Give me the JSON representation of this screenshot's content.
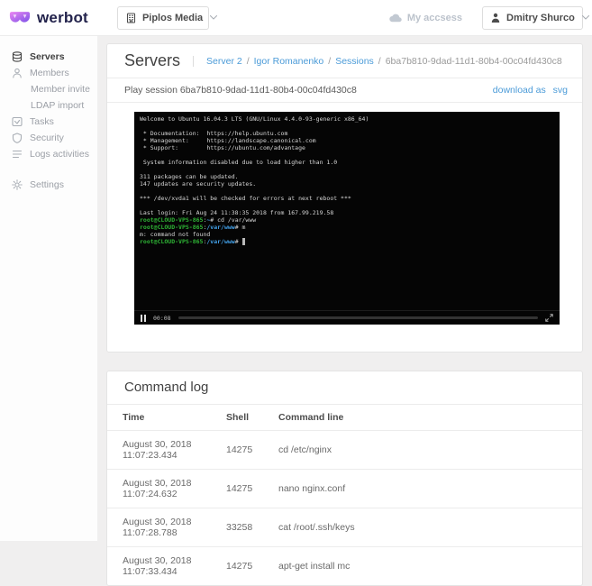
{
  "header": {
    "logo_text": "werbot",
    "company_selector": "Piplos Media",
    "my_access_label": "My accsess",
    "user_name": "Dmitry Shurco"
  },
  "sidebar": {
    "items": [
      {
        "label": "Servers",
        "icon": "server-icon",
        "active": true
      },
      {
        "label": "Members",
        "icon": "user-icon"
      },
      {
        "label": "Member invite",
        "indent": true
      },
      {
        "label": "LDAP import",
        "indent": true
      },
      {
        "label": "Tasks",
        "icon": "tasks-icon"
      },
      {
        "label": "Security",
        "icon": "shield-icon"
      },
      {
        "label": "Logs activities",
        "icon": "logs-icon"
      },
      {
        "label": "Settings",
        "icon": "gear-icon",
        "separated": true
      }
    ]
  },
  "main": {
    "page_title": "Servers",
    "breadcrumb_separator": "/",
    "breadcrumb": [
      {
        "label": "Server 2"
      },
      {
        "label": "Igor Romanenko"
      },
      {
        "label": "Sessions"
      },
      {
        "label": "6ba7b810-9dad-11d1-80b4-00c04fd430c8"
      }
    ],
    "play_session_label": "Play session 6ba7b810-9dad-11d1-80b4-00c04fd430c8",
    "download_as_label": "download as",
    "download_format": "svg"
  },
  "terminal": {
    "player": {
      "time": "00:08",
      "progress_percent": 6
    },
    "lines": [
      [
        {
          "t": "Welcome to Ubuntu 16.04.3 LTS (GNU/Linux 4.4.0-93-generic x86_64)",
          "c": "fg"
        }
      ],
      [],
      [
        {
          "t": " * Documentation:  https://help.ubuntu.com",
          "c": "fg"
        }
      ],
      [
        {
          "t": " * Management:     https://landscape.canonical.com",
          "c": "fg"
        }
      ],
      [
        {
          "t": " * Support:        https://ubuntu.com/advantage",
          "c": "fg"
        }
      ],
      [],
      [
        {
          "t": " System information disabled due to load higher than 1.0",
          "c": "fg"
        }
      ],
      [],
      [
        {
          "t": "311 packages can be updated.",
          "c": "fg"
        }
      ],
      [
        {
          "t": "147 updates are security updates.",
          "c": "fg"
        }
      ],
      [],
      [
        {
          "t": "*** /dev/xvda1 will be checked for errors at next reboot ***",
          "c": "fg"
        }
      ],
      [],
      [
        {
          "t": "Last login: Fri Aug 24 11:38:35 2018 from 167.99.219.58",
          "c": "fg"
        }
      ],
      [
        {
          "t": "root@CLOUD-VPS-865",
          "c": "green"
        },
        {
          "t": ":",
          "c": "fg"
        },
        {
          "t": "~",
          "c": "blue"
        },
        {
          "t": "# cd /var/www",
          "c": "fg"
        }
      ],
      [
        {
          "t": "root@CLOUD-VPS-865",
          "c": "green"
        },
        {
          "t": ":",
          "c": "fg"
        },
        {
          "t": "/var/www",
          "c": "blue"
        },
        {
          "t": "# m",
          "c": "fg"
        }
      ],
      [
        {
          "t": "m: command not found",
          "c": "fg"
        }
      ],
      [
        {
          "t": "root@CLOUD-VPS-865",
          "c": "green"
        },
        {
          "t": ":",
          "c": "fg"
        },
        {
          "t": "/var/www",
          "c": "blue"
        },
        {
          "t": "# ",
          "c": "fg"
        },
        {
          "t": " ",
          "c": "cursor"
        }
      ]
    ]
  },
  "command_log": {
    "title": "Command log",
    "columns": [
      "Time",
      "Shell",
      "Command line"
    ],
    "rows": [
      [
        "August 30, 2018 11:07:23.434",
        "14275",
        "cd /etc/nginx"
      ],
      [
        "August 30, 2018 11:07:24.632",
        "14275",
        "nano nginx.conf"
      ],
      [
        "August 30, 2018 11:07:28.788",
        "33258",
        "cat /root/.ssh/keys"
      ],
      [
        "August 30, 2018 11:07:33.434",
        "14275",
        "apt-get install mc"
      ]
    ]
  },
  "colors": {
    "accent_blue": "#4b9bd8",
    "logo_purple": "#8b5cf6",
    "logo_pink": "#e879f9",
    "terminal_bg": "#050505",
    "terminal_green": "#2eb335",
    "terminal_blue": "#42a0e8"
  }
}
